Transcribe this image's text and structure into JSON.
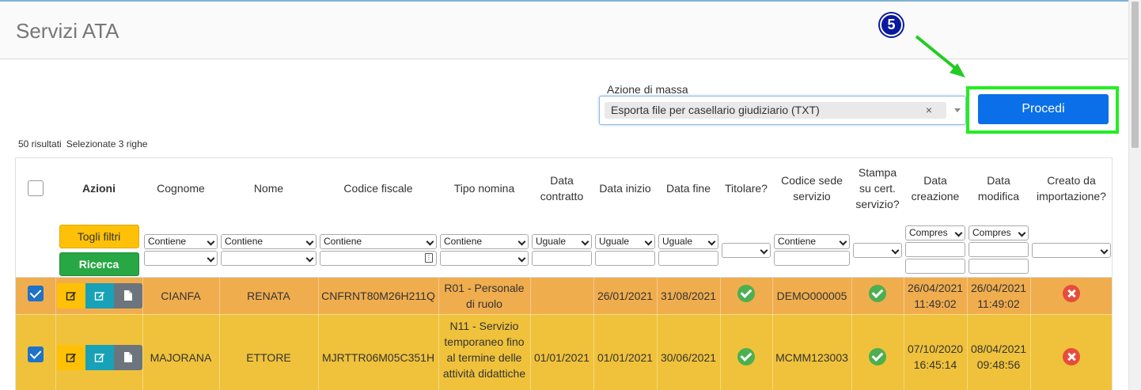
{
  "page": {
    "title": "Servizi ATA"
  },
  "annotation": {
    "step": "5"
  },
  "mass_action": {
    "label": "Azione di massa",
    "selected": "Esporta file per casellario giudiziario (TXT)",
    "clear": "×",
    "proceed_label": "Procedi"
  },
  "summary": {
    "results": "50 risultati",
    "selected": "Selezionate 3 righe"
  },
  "columns": [
    "Azioni",
    "Cognome",
    "Nome",
    "Codice fiscale",
    "Tipo nomina",
    "Data contratto",
    "Data inizio",
    "Data fine",
    "Titolare?",
    "Codice sede servizio",
    "Stampa su cert. servizio?",
    "Data creazione",
    "Data modifica",
    "Creato da importazione?"
  ],
  "filters": {
    "togli_filtri": "Togli filtri",
    "ricerca": "Ricerca",
    "contains": "Contiene",
    "equals": "Uguale",
    "between": "Compres"
  },
  "rows": [
    {
      "cognome": "CIANFA",
      "nome": "RENATA",
      "codice_fiscale": "CNFRNT80M26H211Q",
      "tipo_nomina": "R01 - Personale di ruolo",
      "data_contratto": "",
      "data_inizio": "26/01/2021",
      "data_fine": "31/08/2021",
      "titolare": true,
      "codice_sede": "DEMO000005",
      "stampa_cert": true,
      "data_creazione": "26/04/2021 11:49:02",
      "data_modifica": "26/04/2021 11:49:02",
      "creato_importazione": false,
      "selected": true
    },
    {
      "cognome": "MAJORANA",
      "nome": "ETTORE",
      "codice_fiscale": "MJRTTR06M05C351H",
      "tipo_nomina": "N11 - Servizio temporaneo fino al termine delle attività didattiche",
      "data_contratto": "01/01/2021",
      "data_inizio": "01/01/2021",
      "data_fine": "30/06/2021",
      "titolare": true,
      "codice_sede": "MCMM123003",
      "stampa_cert": true,
      "data_creazione": "07/10/2020 16:45:14",
      "data_modifica": "08/04/2021 09:48:56",
      "creato_importazione": false,
      "selected": true
    }
  ],
  "colors": {
    "accent": "#0a6fe8",
    "row_orange": "#f0ad4e",
    "row_yellow": "#f0c23b",
    "highlight": "#22ee22"
  }
}
